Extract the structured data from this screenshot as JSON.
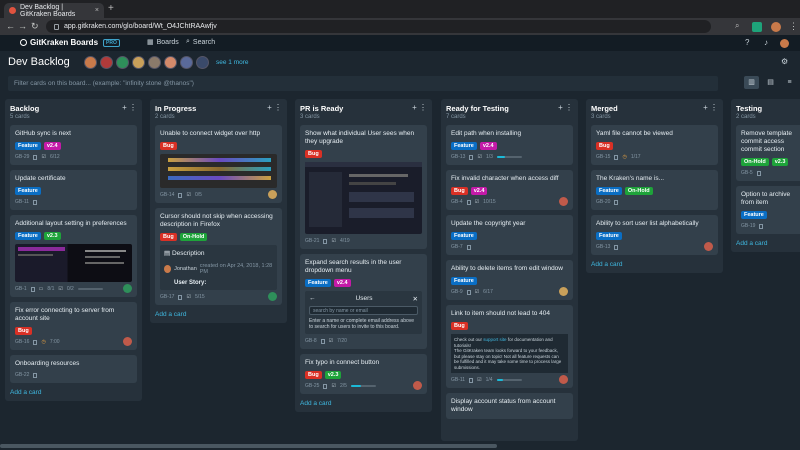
{
  "browser": {
    "tab_title": "Dev Backlog | GitKraken Boards",
    "tab_close": "×",
    "new_tab": "+",
    "url": "app.gitkraken.com/glo/board/Wt_O4JChtRAAwfjv"
  },
  "app": {
    "logo_text": "GitKraken Boards",
    "pro_badge": "PRO",
    "nav_boards": "Boards",
    "nav_search": "Search"
  },
  "board": {
    "title": "Dev Backlog",
    "see_more": "see 1 more",
    "filter_placeholder": "Filter cards on this board... (example: \"infinity stone @thanos\")"
  },
  "columns": {
    "backlog": {
      "title": "Backlog",
      "count": "5 cards",
      "add": "Add a card",
      "cards": [
        {
          "title": "GitHub sync is next",
          "id": "GB-29",
          "checks": "6/12"
        },
        {
          "title": "Update certificate",
          "id": "GB-11"
        },
        {
          "title": "Additional layout setting in preferences",
          "id": "GB-1",
          "counts": "8/1",
          "checks": "0/2"
        },
        {
          "title": "Fix error connecting to server from account site",
          "id": "GB-16",
          "time": "7:00"
        },
        {
          "title": "Onboarding resources",
          "id": "GB-22"
        }
      ]
    },
    "inprogress": {
      "title": "In Progress",
      "count": "2 cards",
      "add": "Add a card",
      "cards": [
        {
          "title": "Unable to connect widget over http",
          "id": "GB-14",
          "checks": "0/5"
        },
        {
          "title": "Cursor should not skip when accessing description in Firefox",
          "id": "GB-17",
          "checks": "5/15",
          "desc_heading": "Description",
          "desc_user": "Jonathan",
          "desc_created": "created on Apr 24, 2018, 1:28 PM",
          "desc_story": "User Story:"
        }
      ]
    },
    "prready": {
      "title": "PR is Ready",
      "count": "3 cards",
      "add": "Add a card",
      "cards": [
        {
          "title": "Show what individual User sees when they upgrade",
          "id": "GB-21",
          "checks": "4/19"
        },
        {
          "title": "Expand search results in the user dropdown menu",
          "id": "GB-8",
          "checks": "7/20",
          "panel_title": "Users",
          "panel_placeholder": "search by name or email",
          "panel_help": "Enter a name or complete email address above to search for users to invite to this board."
        },
        {
          "title": "Fix typo in connect button",
          "id": "GB-25",
          "checks": "2/5"
        }
      ]
    },
    "testingready": {
      "title": "Ready for Testing",
      "count": "7 cards",
      "cards": [
        {
          "title": "Edit path when installing",
          "id": "GB-13",
          "checks": "1/3"
        },
        {
          "title": "Fix invalid character when access diff",
          "id": "GB-4",
          "checks": "10/15"
        },
        {
          "title": "Update the copyright year",
          "id": "GB-7"
        },
        {
          "title": "Ability to delete items from edit window",
          "id": "GB-9",
          "checks": "6/17"
        },
        {
          "title": "Link to item should not lead to 404",
          "id": "GB-11",
          "checks": "1/4",
          "notice_1": "Check out our",
          "notice_link": "support site",
          "notice_2": "for documentation and tutorials!",
          "notice_3": "The GitKraken team looks forward to your feedback, but please stay on topic! Not all feature requests can be fulfilled and it may take some time to process large submissions."
        },
        {
          "title": "Display account status from account window"
        }
      ]
    },
    "merged": {
      "title": "Merged",
      "count": "3 cards",
      "add": "Add a card",
      "cards": [
        {
          "title": "Yaml file cannot be viewed",
          "id": "GB-15",
          "time": "1/17"
        },
        {
          "title": "The Kraken's name is...",
          "id": "GB-20"
        },
        {
          "title": "Ability to sort user list alphabetically",
          "id": "GB-13"
        }
      ]
    },
    "testing": {
      "title": "Testing",
      "count": "2 cards",
      "add": "Add a card",
      "cards": [
        {
          "title": "Remove template commit access commit section",
          "id": "GB-5"
        },
        {
          "title": "Option to archive from item",
          "id": "GB-19"
        }
      ]
    }
  },
  "labels": {
    "feature": "Feature",
    "bug": "Bug",
    "v24": "v2.4",
    "v23": "v2.3",
    "onhold": "On-Hold"
  }
}
